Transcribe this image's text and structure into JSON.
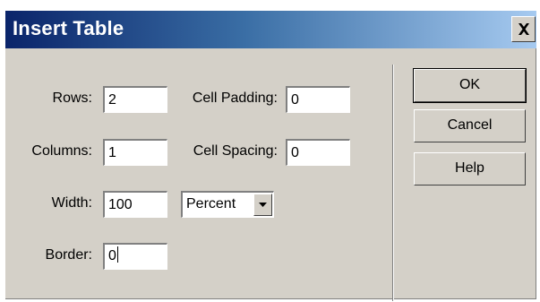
{
  "dialog": {
    "title": "Insert Table",
    "close_glyph": "×"
  },
  "form": {
    "rows": {
      "label": "Rows:",
      "value": "2"
    },
    "columns": {
      "label": "Columns:",
      "value": "1"
    },
    "width": {
      "label": "Width:",
      "value": "100"
    },
    "width_unit": {
      "selected": "Percent"
    },
    "border": {
      "label": "Border:",
      "value": "0"
    },
    "cell_padding": {
      "label": "Cell Padding:",
      "value": "0"
    },
    "cell_spacing": {
      "label": "Cell Spacing:",
      "value": "0"
    }
  },
  "buttons": {
    "ok": "OK",
    "cancel": "Cancel",
    "help": "Help"
  },
  "colors": {
    "title_gradient_start": "#0a246a",
    "title_gradient_end": "#a6caf0",
    "dialog_face": "#d4d0c8"
  }
}
